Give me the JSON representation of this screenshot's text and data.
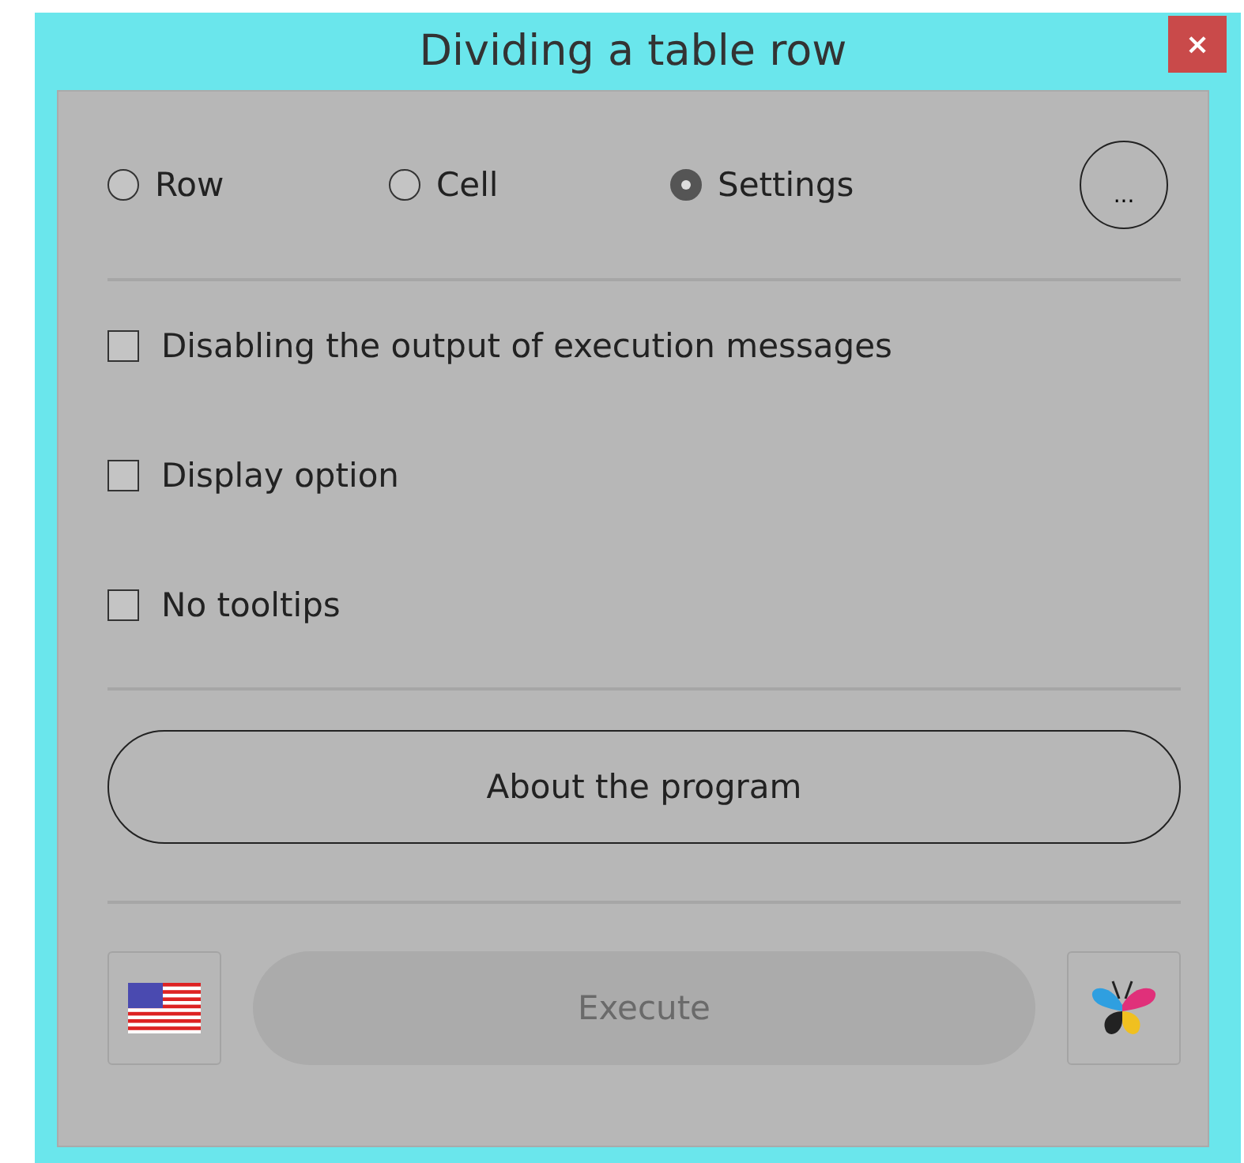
{
  "window": {
    "title": "Dividing a table row",
    "close": "×"
  },
  "modes": [
    {
      "label": "Row",
      "selected": false
    },
    {
      "label": "Cell",
      "selected": false
    },
    {
      "label": "Settings",
      "selected": true
    }
  ],
  "more_button": "...",
  "options": [
    {
      "label": "Disabling the output of execution messages",
      "checked": false
    },
    {
      "label": "Display option",
      "checked": false
    },
    {
      "label": "No tooltips",
      "checked": false
    }
  ],
  "about_button": "About the program",
  "execute_button": {
    "label": "Execute",
    "disabled": true
  }
}
